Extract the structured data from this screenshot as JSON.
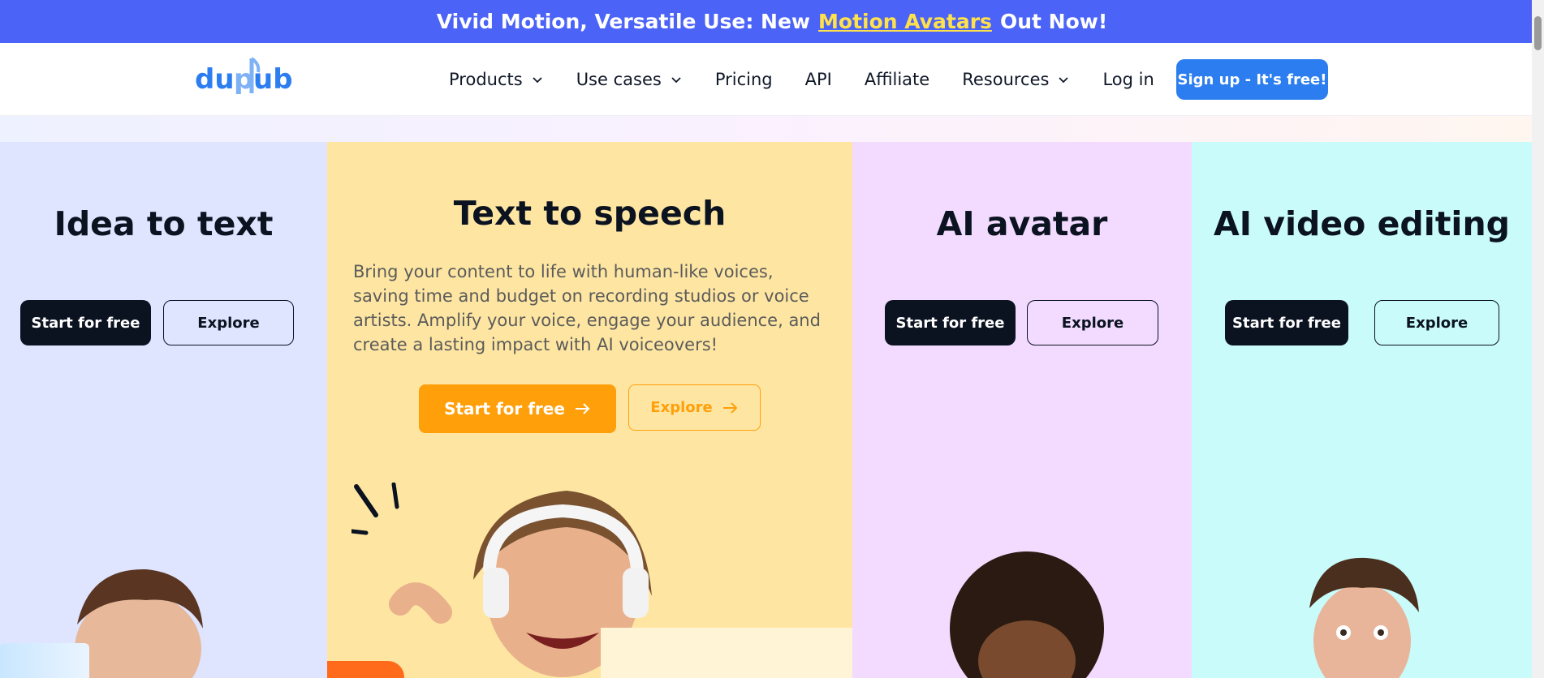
{
  "banner": {
    "before": "Vivid Motion, Versatile Use: New",
    "link": "Motion Avatars",
    "after": "Out Now!"
  },
  "nav": {
    "logo_text": "dupdub",
    "items": [
      {
        "label": "Products",
        "has_caret": true
      },
      {
        "label": "Use cases",
        "has_caret": true
      },
      {
        "label": "Pricing",
        "has_caret": false
      },
      {
        "label": "API",
        "has_caret": false
      },
      {
        "label": "Affiliate",
        "has_caret": false
      },
      {
        "label": "Resources",
        "has_caret": true
      },
      {
        "label": "Log in",
        "has_caret": false
      }
    ],
    "signup_label": "Sign up - It's free!"
  },
  "columns": [
    {
      "title": "Idea to text",
      "start_label": "Start for free",
      "explore_label": "Explore",
      "bg": "#dfe4ff"
    },
    {
      "title": "Text to speech",
      "description": "Bring your content to life with human-like voices, saving time and budget on recording studios or voice artists. Amplify your voice, engage your audience, and create a lasting impact with AI voiceovers!",
      "start_label": "Start for free",
      "explore_label": "Explore",
      "bg": "#fee6a2"
    },
    {
      "title": "AI avatar",
      "start_label": "Start for free",
      "explore_label": "Explore",
      "bg": "#f2dbfe"
    },
    {
      "title": "AI video editing",
      "start_label": "Start for free",
      "explore_label": "Explore",
      "bg": "#c9fbfb"
    }
  ],
  "colors": {
    "banner": "#4b63f7",
    "accent": "#2c7ef0",
    "orange": "#ff9f0a",
    "dark": "#0b1220"
  },
  "icons": [
    "chevron-down-icon",
    "arrow-right-icon"
  ]
}
